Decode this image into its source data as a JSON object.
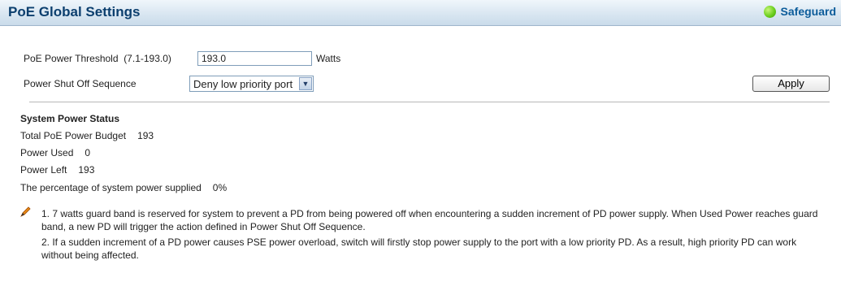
{
  "header": {
    "title": "PoE Global Settings",
    "safeguard_label": "Safeguard"
  },
  "form": {
    "threshold_label": "PoE Power Threshold",
    "threshold_range": "(7.1-193.0)",
    "threshold_value": "193.0",
    "threshold_unit": "Watts",
    "shutoff_label": "Power Shut Off Sequence",
    "shutoff_selected": "Deny low priority port",
    "apply_label": "Apply"
  },
  "status": {
    "title": "System Power Status",
    "budget_label": "Total PoE Power Budget",
    "budget_value": "193",
    "used_label": "Power Used",
    "used_value": "0",
    "left_label": "Power Left",
    "left_value": "193",
    "percent_label": "The percentage of system power supplied",
    "percent_value": "0%"
  },
  "notes": [
    "1. 7 watts guard band is reserved for system to prevent a PD from being powered off when encountering a sudden increment of PD power supply. When Used Power reaches guard band, a new PD will trigger the action defined in Power Shut Off Sequence.",
    "2. If a sudden increment of a PD power causes PSE power overload, switch will firstly stop power supply to the port with a low priority PD. As a result, high priority PD can work without being affected."
  ]
}
